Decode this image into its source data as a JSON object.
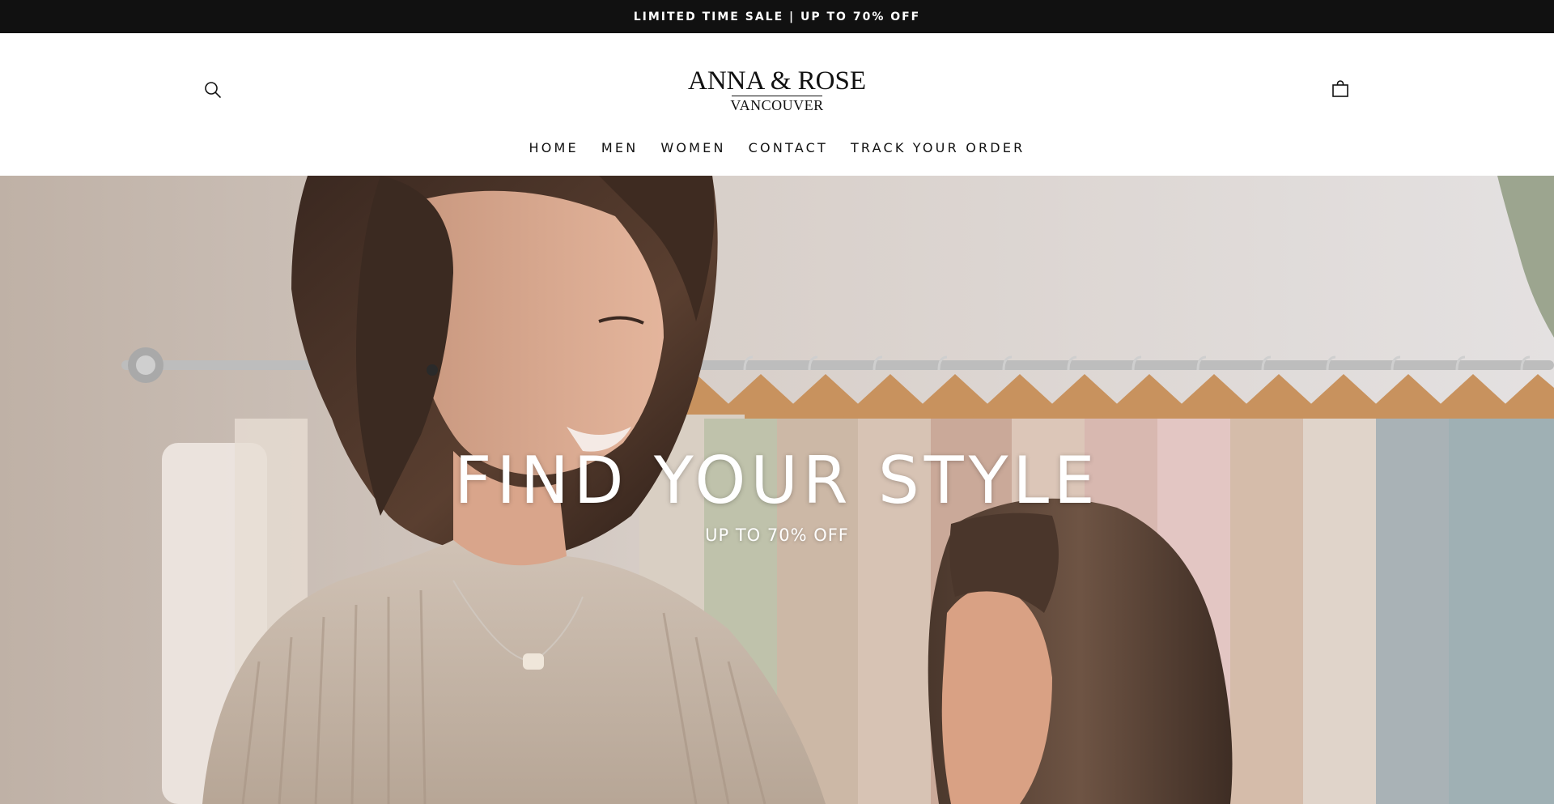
{
  "announcement": {
    "text": "LIMITED TIME SALE | UP TO 70% OFF"
  },
  "header": {
    "logo_line1": "ANNA & ROSE",
    "logo_line2": "VANCOUVER",
    "search_icon": "search-icon",
    "cart_icon": "shopping-bag-icon"
  },
  "nav": {
    "items": [
      {
        "label": "HOME"
      },
      {
        "label": "MEN"
      },
      {
        "label": "WOMEN"
      },
      {
        "label": "CONTACT"
      },
      {
        "label": "TRACK YOUR ORDER"
      }
    ]
  },
  "hero": {
    "title": "FIND YOUR STYLE",
    "subtitle": "UP TO 70% OFF",
    "image_description": "woman-and-girl-at-clothing-rack"
  },
  "colors": {
    "announcement_bg": "#111111",
    "announcement_text": "#ffffff",
    "header_bg": "#ffffff",
    "text": "#111111",
    "hero_text": "#ffffff"
  }
}
